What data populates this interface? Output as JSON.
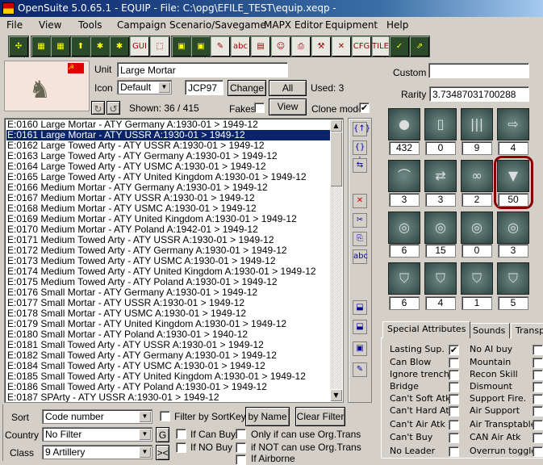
{
  "window": {
    "title": "OpenSuite  5.0.65.1 - EQUIP - File: C:\\opg\\EFILE_TEST\\equip.xeqp -"
  },
  "menu": [
    "File",
    "View",
    "Tools",
    "Campaign",
    "Scenario/Savegame",
    "MAPX Editor",
    "Equipment",
    "Help"
  ],
  "toolbar": {
    "icons": [
      "unit-move-icon",
      "map-icon",
      "map-edit-icon",
      "load-icon",
      "xxx-icon",
      "unit-icon",
      "gui-folder-icon",
      "select-icon",
      "save-icon",
      "save-as-icon",
      "eraser-icon",
      "spell-check-icon",
      "notes-icon",
      "leader-icon",
      "print-icon",
      "build-icon",
      "delete-x-icon",
      "cfg-icon",
      "tiles-icon",
      "check-icon",
      "export-icon"
    ],
    "gui_label": "GUI",
    "abc_label": "abc",
    "cfg_label": "CFG",
    "tiles_label": "TILES"
  },
  "unit": {
    "unit_label": "Unit",
    "name": "Large Mortar",
    "icon_label": "Icon",
    "icon_select": "Default",
    "icon_code": "JCP97",
    "change_label": "Change",
    "all_same_label": "All same",
    "used": "Used:  3",
    "shown": "Shown: 36 / 415",
    "fakes_label": "Fakes",
    "fakes_checked": false,
    "view_label": "View",
    "clone_mode_label": "Clone mode",
    "clone_mode_checked": true,
    "custom_label": "Custom",
    "custom_value": "",
    "rarity_label": "Rarity",
    "rarity_value": "3.73487031700288"
  },
  "list": {
    "selected_index": 1,
    "items": [
      "E:0160  Large Mortar - ATY  Germany  A:1930-01 > 1949-12",
      "E:0161  Large Mortar - ATY  USSR  A:1930-01 > 1949-12",
      "E:0162  Large Towed Arty - ATY  USSR  A:1930-01 > 1949-12",
      "E:0163  Large Towed Arty - ATY  Germany  A:1930-01 > 1949-12",
      "E:0164  Large Towed Arty - ATY  USMC  A:1930-01 > 1949-12",
      "E:0165  Large Towed Arty - ATY  United Kingdom  A:1930-01 > 1949-12",
      "E:0166  Medium Mortar - ATY  Germany  A:1930-01 > 1949-12",
      "E:0167  Medium Mortar - ATY  USSR  A:1930-01 > 1949-12",
      "E:0168  Medium Mortar - ATY  USMC  A:1930-01 > 1949-12",
      "E:0169  Medium Mortar - ATY  United Kingdom  A:1930-01 > 1949-12",
      "E:0170  Medium Mortar - ATY  Poland  A:1942-01 > 1949-12",
      "E:0171  Medium Towed Arty - ATY  USSR  A:1930-01 > 1949-12",
      "E:0172  Medium Towed Arty - ATY  Germany  A:1930-01 > 1949-12",
      "E:0173  Medium Towed Arty - ATY  USMC  A:1930-01 > 1949-12",
      "E:0174  Medium Towed Arty - ATY  United Kingdom  A:1930-01 > 1949-12",
      "E:0175  Medium Towed Arty - ATY  Poland  A:1930-01 > 1949-12",
      "E:0176  Small Mortar - ATY  Germany  A:1930-01 > 1949-12",
      "E:0177  Small Mortar - ATY  USSR  A:1930-01 > 1949-12",
      "E:0178  Small Mortar - ATY  USMC  A:1930-01 > 1949-12",
      "E:0179  Small Mortar - ATY  United Kingdom  A:1930-01 > 1949-12",
      "E:0180  Small Mortar - ATY  Poland  A:1930-01 > 1940-12",
      "E:0181  Small Towed Arty - ATY  USSR  A:1930-01 > 1949-12",
      "E:0182  Small Towed Arty - ATY  Germany  A:1930-01 > 1949-12",
      "E:0184  Small Towed Arty - ATY  USMC  A:1930-01 > 1949-12",
      "E:0185  Small Towed Arty - ATY  United Kingdom  A:1930-01 > 1949-12",
      "E:0186  Small Towed Arty - ATY  Poland  A:1930-01 > 1949-12",
      "E:0187  SPArty - ATY  USSR  A:1930-01 > 1949-12"
    ]
  },
  "side_tools": [
    "move-up-icon",
    "move-down-icon",
    "swap-icon",
    "delete-icon",
    "cut-icon",
    "copy-icon",
    "rename-icon",
    "import-icon",
    "export-icon",
    "folder-icon",
    "edit-icon"
  ],
  "stats": [
    {
      "icon": "cost-coin-icon",
      "glyph": "●",
      "value": "432"
    },
    {
      "icon": "fuel-can-icon",
      "glyph": "▯",
      "value": "0"
    },
    {
      "icon": "ammo-icon",
      "glyph": "|||",
      "value": "9"
    },
    {
      "icon": "movement-icon",
      "glyph": "⇨",
      "value": "4"
    },
    {
      "icon": "range-arc-icon",
      "glyph": "⌒",
      "value": "3"
    },
    {
      "icon": "initiative-icon",
      "glyph": "⇄",
      "value": "3"
    },
    {
      "icon": "spotting-binoculars-icon",
      "glyph": "∞",
      "value": "2"
    },
    {
      "icon": "shell-icon",
      "glyph": "▼",
      "value": "50",
      "highlighted": true
    },
    {
      "icon": "soft-attack-target-icon",
      "glyph": "◎",
      "value": "6"
    },
    {
      "icon": "infantry-target-icon",
      "glyph": "◎",
      "value": "15"
    },
    {
      "icon": "air-target-icon",
      "glyph": "◎",
      "value": "0"
    },
    {
      "icon": "naval-target-icon",
      "glyph": "◎",
      "value": "3"
    },
    {
      "icon": "ground-defense-icon",
      "glyph": "⛉",
      "value": "6"
    },
    {
      "icon": "air-defense-icon",
      "glyph": "⛉",
      "value": "4"
    },
    {
      "icon": "close-defense-icon",
      "glyph": "⛉",
      "value": "1"
    },
    {
      "icon": "arc-defense-icon",
      "glyph": "⛉",
      "value": "5"
    }
  ],
  "highlight_color": "#8b0000",
  "tabs": [
    "Special Attributes",
    "Sounds",
    "Transp"
  ],
  "attributes": {
    "col1": [
      {
        "label": "Lasting Sup.",
        "checked": true
      },
      {
        "label": "Can Blow",
        "checked": false
      },
      {
        "label": "Ignore trench",
        "checked": false
      },
      {
        "label": "Bridge",
        "checked": false
      },
      {
        "label": "Can't Soft Atk",
        "checked": false
      },
      {
        "label": "Can't Hard Atk",
        "checked": false
      },
      {
        "label": "Can't Air  Atk",
        "checked": false
      },
      {
        "label": "Can't Buy",
        "checked": false
      },
      {
        "label": "No Leader",
        "checked": false
      }
    ],
    "col2": [
      {
        "label": "No AI buy",
        "checked": false
      },
      {
        "label": "Mountain",
        "checked": false
      },
      {
        "label": "Recon Skill",
        "checked": false
      },
      {
        "label": "Dismount",
        "checked": false
      },
      {
        "label": "Support Fire.",
        "checked": false
      },
      {
        "label": "Air Support",
        "checked": false
      },
      {
        "label": "Air Transptable",
        "checked": false
      },
      {
        "label": "CAN Air  Atk",
        "checked": false
      },
      {
        "label": "Overrun toggle",
        "checked": false
      }
    ]
  },
  "filters": {
    "sort_label": "Sort",
    "sort_value": "Code number",
    "filter_sortkey_label": "Filter by SortKey",
    "by_name_label": "by Name",
    "clear_filter_label": "Clear Filter",
    "country_label": "Country",
    "country_value": "No Filter",
    "g_label": "G",
    "class_label": "Class",
    "class_value": "9  Artillery",
    "swap_label": "><",
    "if_can_buy": "If Can Buy",
    "if_no_buy": "If NO Buy",
    "only_org": "Only if can use Org.Trans",
    "not_org": "if NOT can use Org.Trans",
    "if_airborne": "If Airborne"
  }
}
